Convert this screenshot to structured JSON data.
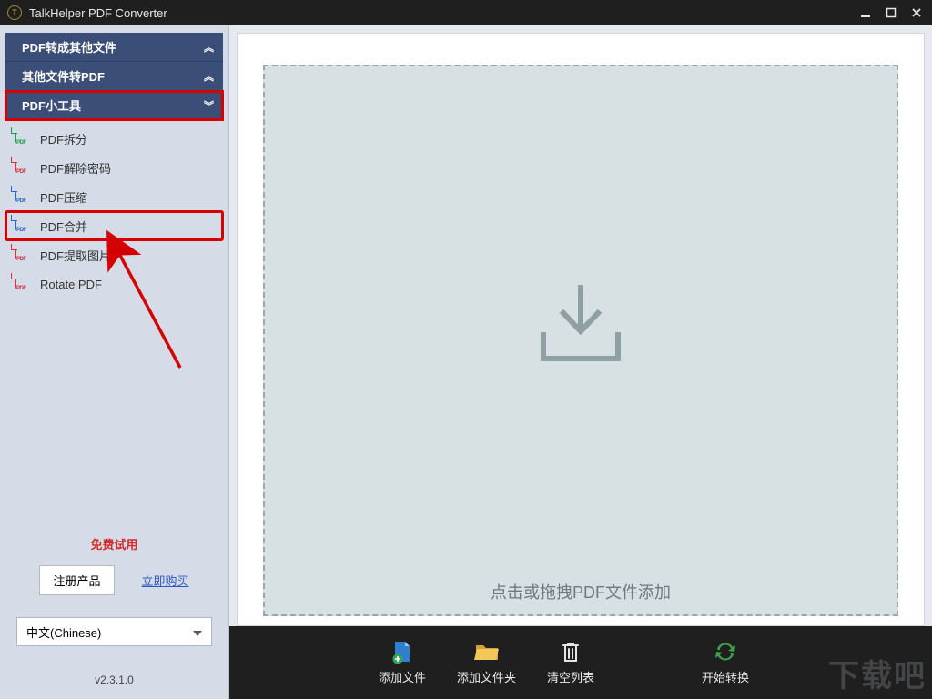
{
  "titlebar": {
    "title": "TalkHelper PDF Converter"
  },
  "sidebar": {
    "sections": [
      {
        "label": "PDF转成其他文件",
        "expanded": false
      },
      {
        "label": "其他文件转PDF",
        "expanded": false
      },
      {
        "label": "PDF小工具",
        "expanded": true
      }
    ],
    "tools": [
      {
        "label": "PDF拆分",
        "color": "green"
      },
      {
        "label": "PDF解除密码",
        "color": "red"
      },
      {
        "label": "PDF压缩",
        "color": "blue"
      },
      {
        "label": "PDF合并",
        "color": "blue",
        "highlighted": true
      },
      {
        "label": "PDF提取图片",
        "color": "red"
      },
      {
        "label": "Rotate PDF",
        "color": "red"
      }
    ],
    "trial_label": "免费试用",
    "register_label": "注册产品",
    "buy_label": "立即购买",
    "language_label": "中文(Chinese)",
    "version_label": "v2.3.1.0"
  },
  "main": {
    "drop_hint": "点击或拖拽PDF文件添加"
  },
  "bottombar": {
    "add_file": "添加文件",
    "add_folder": "添加文件夹",
    "clear_list": "清空列表",
    "start_convert": "开始转换"
  },
  "watermark": "下载吧"
}
